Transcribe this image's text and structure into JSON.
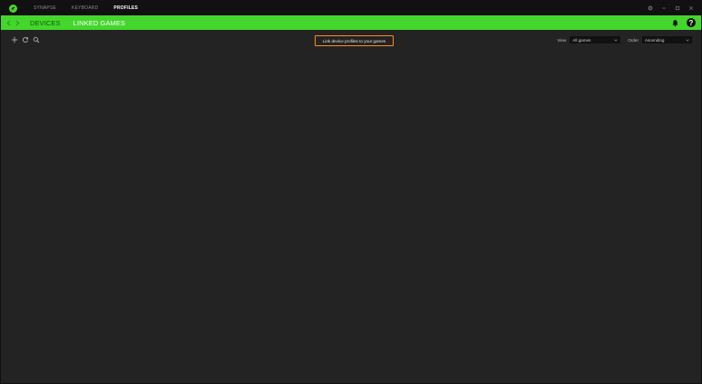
{
  "titlebar": {
    "logo_icon": "razer-logo-icon",
    "tabs": [
      {
        "label": "SYNAPSE",
        "active": false
      },
      {
        "label": "KEYBOARD",
        "active": false
      },
      {
        "label": "PROFILES",
        "active": true
      }
    ],
    "window_controls": [
      "settings-icon",
      "minimize-icon",
      "maximize-icon",
      "close-icon"
    ]
  },
  "subheader": {
    "tabs": [
      {
        "label": "DEVICES",
        "active": false
      },
      {
        "label": "LINKED GAMES",
        "active": true
      }
    ],
    "help_label": "?"
  },
  "toolbar": {
    "icons": [
      "add-icon",
      "refresh-icon",
      "search-icon"
    ],
    "link_button_label": "Link device profiles to your games",
    "view_label": "View",
    "view_value": "All games",
    "order_label": "Order",
    "order_value": "Ascending"
  },
  "colors": {
    "accent": "#44d62c",
    "titlebar": "#111111",
    "background": "#232323",
    "highlight_border": "#ff8a1a"
  }
}
